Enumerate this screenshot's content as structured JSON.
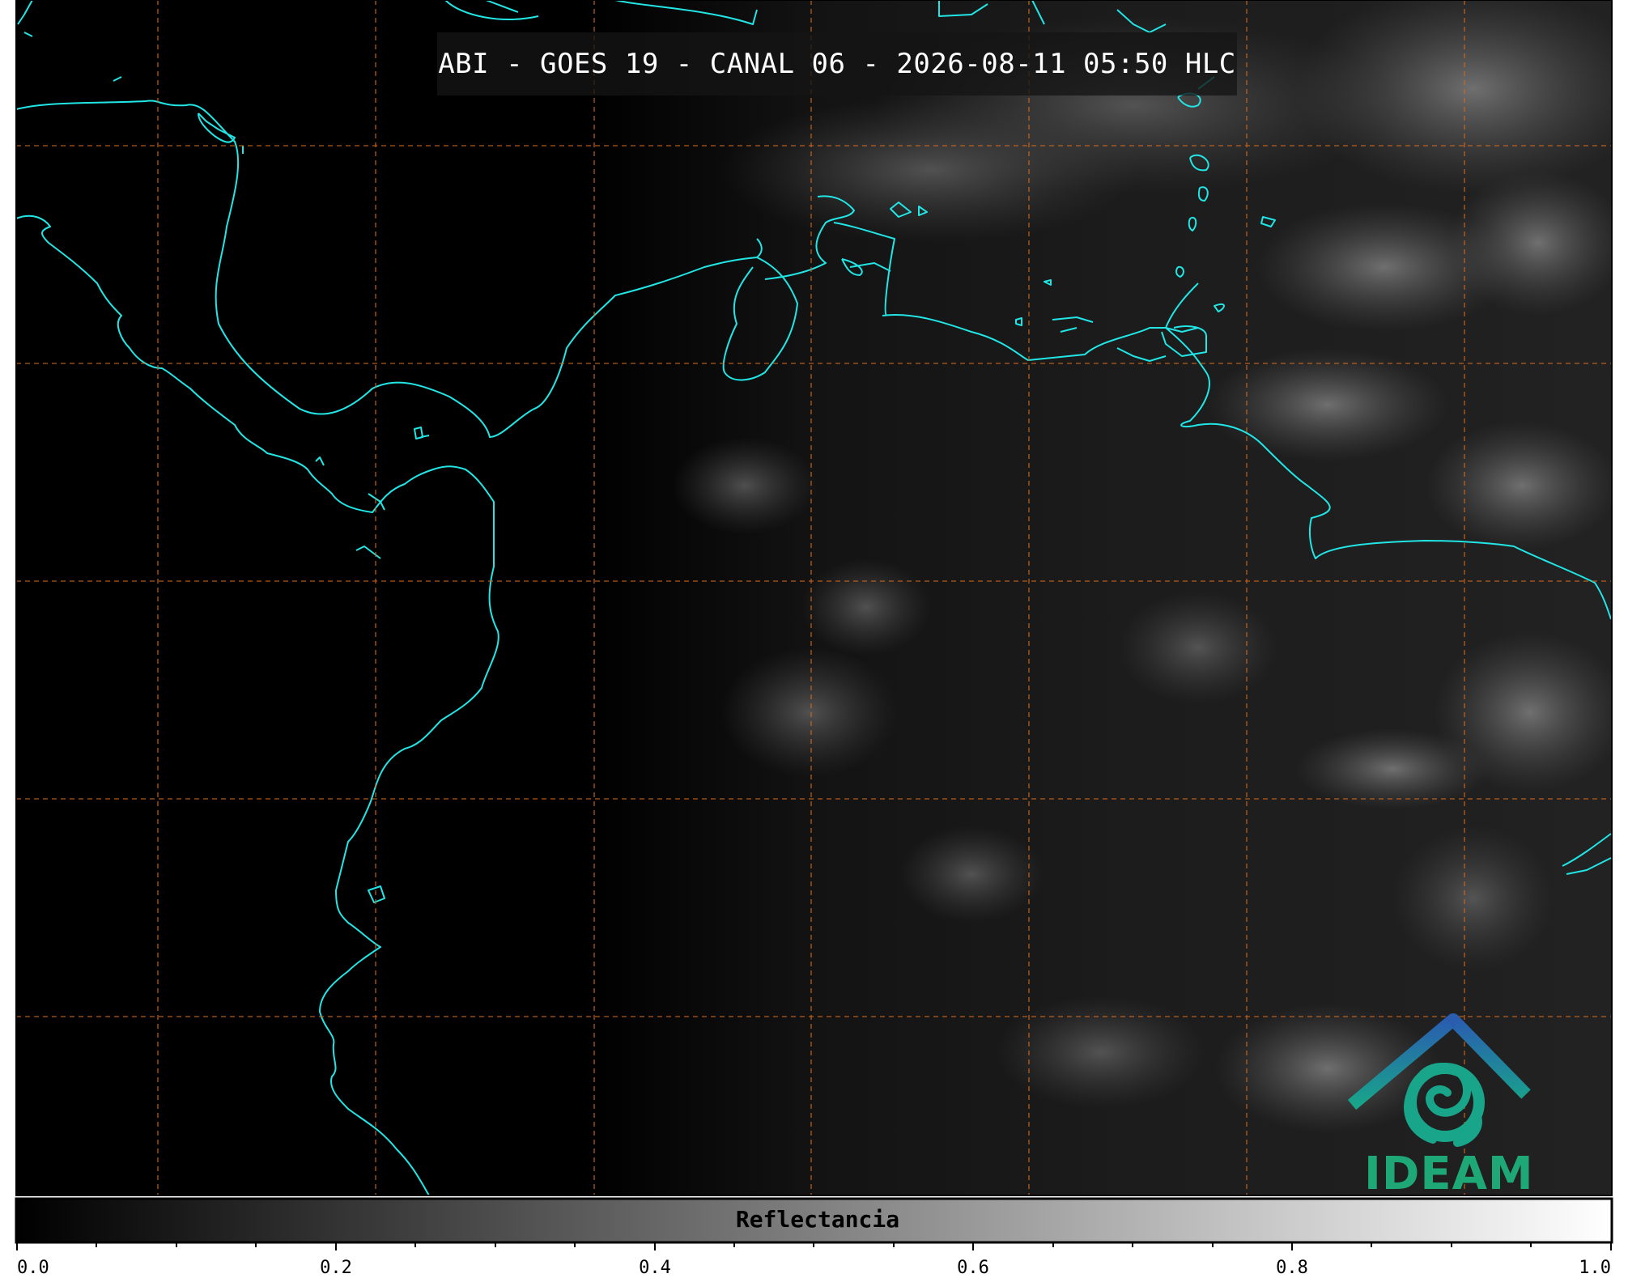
{
  "title": "ABI - GOES 19 - CANAL 06 - 2026-08-11 05:50 HLC",
  "colorbar": {
    "label": "Reflectancia",
    "ticks": [
      "0.0",
      "0.2",
      "0.4",
      "0.6",
      "0.8",
      "1.0"
    ],
    "range": [
      0.0,
      1.0
    ],
    "colormap": "greys"
  },
  "logo": {
    "text": "IDEAM",
    "colors": {
      "roof": "#2f6fb8",
      "swirl": "#18a58a",
      "text": "#1fa877"
    }
  },
  "colors": {
    "coastline": "#22e6e6",
    "gridlines": "#d2691e",
    "background": "#000000"
  }
}
